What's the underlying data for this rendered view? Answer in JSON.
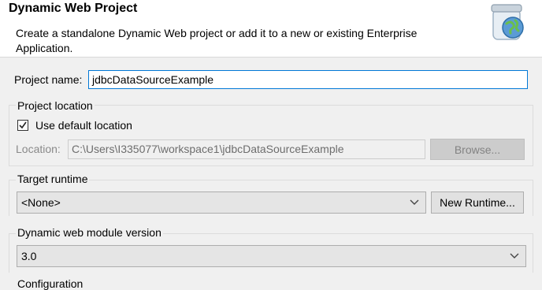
{
  "header": {
    "title": "Dynamic Web Project",
    "description": "Create a standalone Dynamic Web project or add it to a new or existing Enterprise Application.",
    "icon": "web-project-jar-globe-icon"
  },
  "project_name": {
    "label": "Project name:",
    "value": "jdbcDataSourceExample"
  },
  "project_location": {
    "group_label": "Project location",
    "use_default_label": "Use default location",
    "use_default_checked": true,
    "location_label": "Location:",
    "location_value": "C:\\Users\\I335077\\workspace1\\jdbcDataSourceExample",
    "browse_label": "Browse..."
  },
  "target_runtime": {
    "group_label": "Target runtime",
    "selected": "<None>",
    "new_runtime_label": "New Runtime..."
  },
  "module_version": {
    "group_label": "Dynamic web module version",
    "selected": "3.0"
  },
  "configuration": {
    "group_label": "Configuration"
  },
  "colors": {
    "focus_border": "#0078d7",
    "dialog_bg": "#f0f0f0"
  }
}
